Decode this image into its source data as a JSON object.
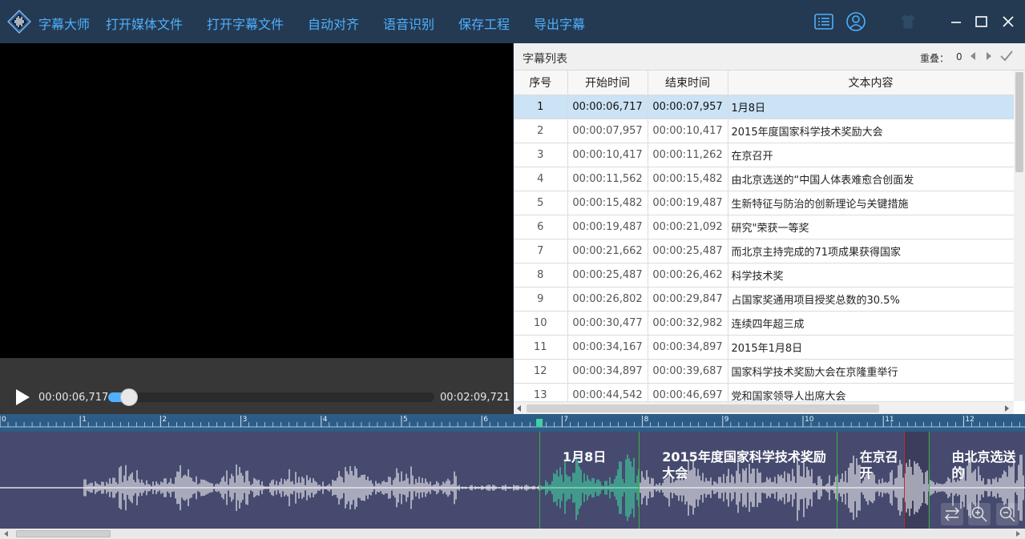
{
  "app": {
    "title": "字幕大师",
    "menu": [
      "打开媒体文件",
      "打开字幕文件",
      "自动对齐",
      "语音识别",
      "保存工程",
      "导出字幕"
    ]
  },
  "player": {
    "current_time": "00:00:06,717",
    "total_time": "00:02:09,721",
    "progress": 0.052
  },
  "panel": {
    "title": "字幕列表",
    "overlap_label": "重叠：",
    "overlap_count": "0"
  },
  "table": {
    "headers": [
      "序号",
      "开始时间",
      "结束时间",
      "文本内容"
    ],
    "rows": [
      {
        "idx": "1",
        "start": "00:00:06,717",
        "end": "00:00:07,957",
        "text": "1月8日"
      },
      {
        "idx": "2",
        "start": "00:00:07,957",
        "end": "00:00:10,417",
        "text": "2015年度国家科学技术奖励大会"
      },
      {
        "idx": "3",
        "start": "00:00:10,417",
        "end": "00:00:11,262",
        "text": "在京召开"
      },
      {
        "idx": "4",
        "start": "00:00:11,562",
        "end": "00:00:15,482",
        "text": "由北京选送的“中国人体表难愈合创面发"
      },
      {
        "idx": "5",
        "start": "00:00:15,482",
        "end": "00:00:19,487",
        "text": "生新特征与防治的创新理论与关键措施"
      },
      {
        "idx": "6",
        "start": "00:00:19,487",
        "end": "00:00:21,092",
        "text": "研究\"荣获一等奖"
      },
      {
        "idx": "7",
        "start": "00:00:21,662",
        "end": "00:00:25,487",
        "text": "而北京主持完成的71项成果获得国家"
      },
      {
        "idx": "8",
        "start": "00:00:25,487",
        "end": "00:00:26,462",
        "text": "科学技术奖"
      },
      {
        "idx": "9",
        "start": "00:00:26,802",
        "end": "00:00:29,847",
        "text": "占国家奖通用项目授奖总数的30.5%"
      },
      {
        "idx": "10",
        "start": "00:00:30,477",
        "end": "00:00:32,982",
        "text": "连续四年超三成"
      },
      {
        "idx": "11",
        "start": "00:00:34,167",
        "end": "00:00:34,897",
        "text": "2015年1月8日"
      },
      {
        "idx": "12",
        "start": "00:00:34,897",
        "end": "00:00:39,687",
        "text": "国家科学技术奖励大会在京隆重举行"
      },
      {
        "idx": "13",
        "start": "00:00:44,542",
        "end": "00:00:46,697",
        "text": "党和国家领导人出席大会"
      }
    ],
    "selected_row": 0
  },
  "timeline": {
    "ruler_labels": [
      "0",
      "1",
      "2",
      "3",
      "4",
      "5",
      "6",
      "7",
      "8",
      "9",
      "10",
      "11",
      "12"
    ],
    "segments": [
      {
        "text": "1月8日",
        "start": 6.717,
        "end": 7.957
      },
      {
        "text": "2015年度国家科学技术奖励大会",
        "start": 7.957,
        "end": 10.417
      },
      {
        "text": "在京召开",
        "start": 10.417,
        "end": 11.262
      },
      {
        "text": "由北京选送的",
        "start": 11.562,
        "end": 15.482
      }
    ],
    "playhead": 6.717
  },
  "icons": {
    "logo": "waveform-logo-icon",
    "list": "list-icon",
    "user": "user-icon",
    "skin": "shirt-icon",
    "minimize": "minimize-icon",
    "maximize": "maximize-icon",
    "close": "close-icon",
    "prev": "triangle-left-icon",
    "next": "triangle-right-icon",
    "confirm": "checkmark-icon",
    "play": "play-icon",
    "swap": "swap-icon",
    "zoom_in": "zoom-in-icon",
    "zoom_out": "zoom-out-icon"
  },
  "colors": {
    "accent": "#4fb0ff",
    "topbar": "#243a52",
    "selected_row": "#cce2f5",
    "wave_active": "#3fd1a0",
    "wave_bg": "#464a6e",
    "ruler": "#2d5d87",
    "segment_green_line": "#3cb045",
    "segment_red_line": "#c02a2a"
  }
}
